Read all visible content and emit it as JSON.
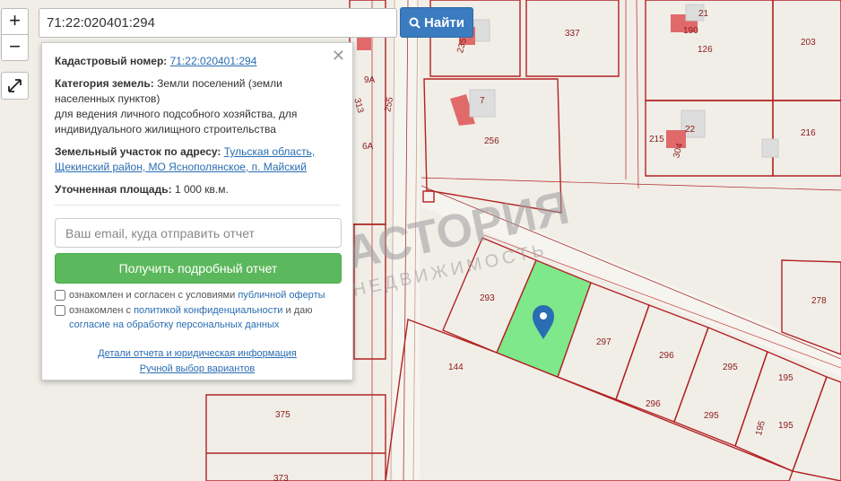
{
  "search": {
    "value": "71:22:020401:294",
    "button_label": "Найти"
  },
  "zoom": {
    "in_label": "+",
    "out_label": "−"
  },
  "popup": {
    "cadastral_label": "Кадастровый номер:",
    "cadastral_value": "71:22:020401:294",
    "category_label": "Категория земель:",
    "category_value": "Земли поселений (земли населенных пунктов)",
    "use_value": "для ведения личного подсобного хозяйства, для индивидуального жилищного строительства",
    "address_label": "Земельный участок по адресу:",
    "address_value": "Тульская область, Щекинский район, МО Яснополянское, п. Майский",
    "area_label": "Уточненная площадь:",
    "area_value": "1 000 кв.м.",
    "email_placeholder": "Ваш email, куда отправить отчет",
    "report_button": "Получить подробный отчет",
    "consent1_text": "ознакомлен и согласен с условиями",
    "consent1_link": "публичной оферты",
    "consent2_text": "ознакомлен с",
    "consent2_link1": "политикой конфиденциальности",
    "consent2_mid": "и даю",
    "consent2_link2": "согласие на обработку персональных данных",
    "details_link": "Детали отчета и юридическая информация",
    "manual_link": "Ручной выбор вариантов"
  },
  "watermark": {
    "title": "АСТОРИЯ",
    "subtitle": "НЕДВИЖИМОСТЬ"
  },
  "map_labels": {
    "l337": "337",
    "l203": "203",
    "l126": "126",
    "l190": "190",
    "l21": "21",
    "l235": "235",
    "l256": "256",
    "l7": "7",
    "l216": "216",
    "l215": "215",
    "l22": "22",
    "l304": "304",
    "l293": "293",
    "l297": "297",
    "l296a": "296",
    "l295a": "295",
    "l278": "278",
    "l144": "144",
    "l296b": "296",
    "l295b": "295",
    "l195a": "195",
    "l195b": "195",
    "l195c": "195",
    "l375": "375",
    "l373": "373",
    "l255": "255",
    "l313": "313",
    "l9a": "9А",
    "l6a": "6А"
  },
  "colors": {
    "plot_line": "#b22222",
    "selected_fill": "#7ee88a",
    "marker": "#2a6db2",
    "button_blue": "#3b7bbf",
    "button_green": "#5cb85c"
  }
}
